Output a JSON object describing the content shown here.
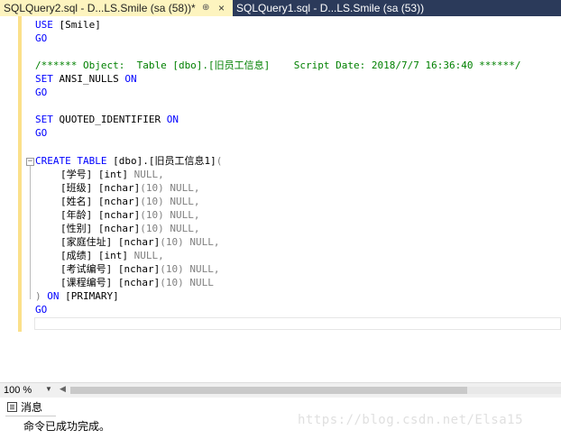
{
  "tabs": {
    "active_title": "SQLQuery2.sql - D...LS.Smile (sa (58))*",
    "pin_glyph": "⊕",
    "close_glyph": "×",
    "inactive_title": "SQLQuery1.sql - D...LS.Smile (sa (53))"
  },
  "editor": {
    "l1": {
      "kw": "USE",
      "rest": " [Smile]"
    },
    "l2": {
      "kw": "GO"
    },
    "l4": {
      "comment": "/****** Object:  Table [dbo].[旧员工信息]    Script Date: 2018/7/7 16:36:40 ******/"
    },
    "l5": {
      "kw": "SET",
      "rest": " ANSI_NULLS ",
      "kw2": "ON"
    },
    "l6": {
      "kw": "GO"
    },
    "l8": {
      "kw": "SET",
      "rest": " QUOTED_IDENTIFIER ",
      "kw2": "ON"
    },
    "l9": {
      "kw": "GO"
    },
    "l11": {
      "kw": "CREATE TABLE",
      "rest": " [dbo].[旧员工信息1]",
      "paren": "("
    },
    "cols": [
      {
        "name": "[学号]",
        "type": " [int] ",
        "size": "",
        "null": "NULL,"
      },
      {
        "name": "[班级]",
        "type": " [nchar]",
        "size": "(10) ",
        "null": "NULL,"
      },
      {
        "name": "[姓名]",
        "type": " [nchar]",
        "size": "(10) ",
        "null": "NULL,"
      },
      {
        "name": "[年龄]",
        "type": " [nchar]",
        "size": "(10) ",
        "null": "NULL,"
      },
      {
        "name": "[性别]",
        "type": " [nchar]",
        "size": "(10) ",
        "null": "NULL,"
      },
      {
        "name": "[家庭住址]",
        "type": " [nchar]",
        "size": "(10) ",
        "null": "NULL,"
      },
      {
        "name": "[成绩]",
        "type": " [int] ",
        "size": "",
        "null": "NULL,"
      },
      {
        "name": "[考试编号]",
        "type": " [nchar]",
        "size": "(10) ",
        "null": "NULL,"
      },
      {
        "name": "[课程编号]",
        "type": " [nchar]",
        "size": "(10) ",
        "null": "NULL"
      }
    ],
    "l21": {
      "paren": ")",
      "kw": " ON",
      "rest": " [PRIMARY]"
    },
    "l22": {
      "kw": "GO"
    }
  },
  "statusbar": {
    "zoom": "100 %"
  },
  "results": {
    "tab_label": "消息",
    "message": "命令已成功完成。"
  },
  "watermark": "https://blog.csdn.net/Elsa15",
  "colors": {
    "keyword": "#0000ff",
    "comment": "#008000",
    "gray": "#808080",
    "active_tab": "#fdf4bf",
    "tabbar": "#2b3a5a"
  }
}
